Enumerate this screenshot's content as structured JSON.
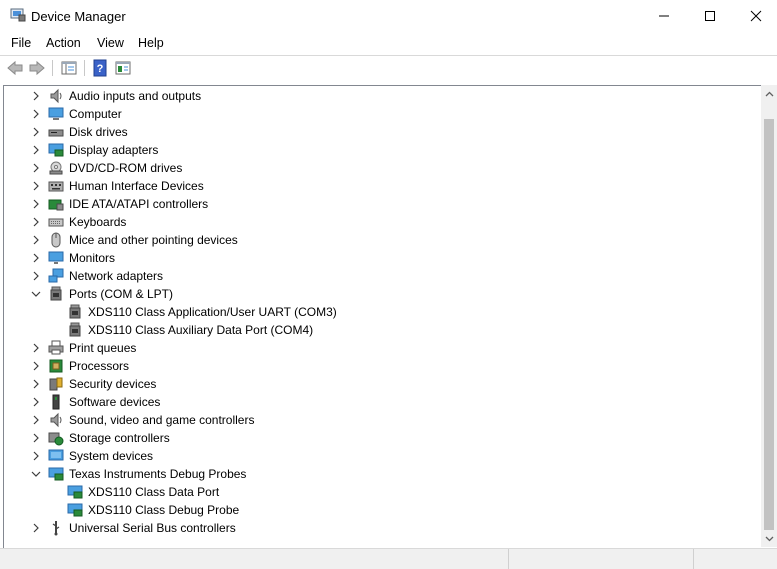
{
  "window": {
    "title": "Device Manager"
  },
  "menu": [
    "File",
    "Action",
    "View",
    "Help"
  ],
  "colors": {
    "accent_blue": "#1e73c8",
    "green_chip": "#2a8a3a"
  },
  "tree": [
    {
      "label": "Audio inputs and outputs",
      "icon": "speaker-icon",
      "expanded": false,
      "children": []
    },
    {
      "label": "Computer",
      "icon": "computer-icon",
      "expanded": false,
      "children": []
    },
    {
      "label": "Disk drives",
      "icon": "disk-drive-icon",
      "expanded": false,
      "children": []
    },
    {
      "label": "Display adapters",
      "icon": "display-adapter-icon",
      "expanded": false,
      "children": []
    },
    {
      "label": "DVD/CD-ROM drives",
      "icon": "dvd-drive-icon",
      "expanded": false,
      "children": []
    },
    {
      "label": "Human Interface Devices",
      "icon": "hid-icon",
      "expanded": false,
      "children": []
    },
    {
      "label": "IDE ATA/ATAPI controllers",
      "icon": "ide-controller-icon",
      "expanded": false,
      "children": []
    },
    {
      "label": "Keyboards",
      "icon": "keyboard-icon",
      "expanded": false,
      "children": []
    },
    {
      "label": "Mice and other pointing devices",
      "icon": "mouse-icon",
      "expanded": false,
      "children": []
    },
    {
      "label": "Monitors",
      "icon": "monitor-icon",
      "expanded": false,
      "children": []
    },
    {
      "label": "Network adapters",
      "icon": "network-adapter-icon",
      "expanded": false,
      "children": []
    },
    {
      "label": "Ports (COM & LPT)",
      "icon": "port-icon",
      "expanded": true,
      "children": [
        {
          "label": "XDS110 Class Application/User UART (COM3)",
          "icon": "port-icon"
        },
        {
          "label": "XDS110 Class Auxiliary Data Port (COM4)",
          "icon": "port-icon"
        }
      ]
    },
    {
      "label": "Print queues",
      "icon": "printer-icon",
      "expanded": false,
      "children": []
    },
    {
      "label": "Processors",
      "icon": "processor-icon",
      "expanded": false,
      "children": []
    },
    {
      "label": "Security devices",
      "icon": "security-device-icon",
      "expanded": false,
      "children": []
    },
    {
      "label": "Software devices",
      "icon": "software-device-icon",
      "expanded": false,
      "children": []
    },
    {
      "label": "Sound, video and game controllers",
      "icon": "speaker-icon",
      "expanded": false,
      "children": []
    },
    {
      "label": "Storage controllers",
      "icon": "storage-controller-icon",
      "expanded": false,
      "children": []
    },
    {
      "label": "System devices",
      "icon": "system-device-icon",
      "expanded": false,
      "children": []
    },
    {
      "label": "Texas Instruments Debug Probes",
      "icon": "debug-probe-icon",
      "expanded": true,
      "children": [
        {
          "label": "XDS110 Class Data Port",
          "icon": "debug-probe-icon"
        },
        {
          "label": "XDS110 Class Debug Probe",
          "icon": "debug-probe-icon"
        }
      ]
    },
    {
      "label": "Universal Serial Bus controllers",
      "icon": "usb-icon",
      "expanded": false,
      "children": []
    }
  ]
}
